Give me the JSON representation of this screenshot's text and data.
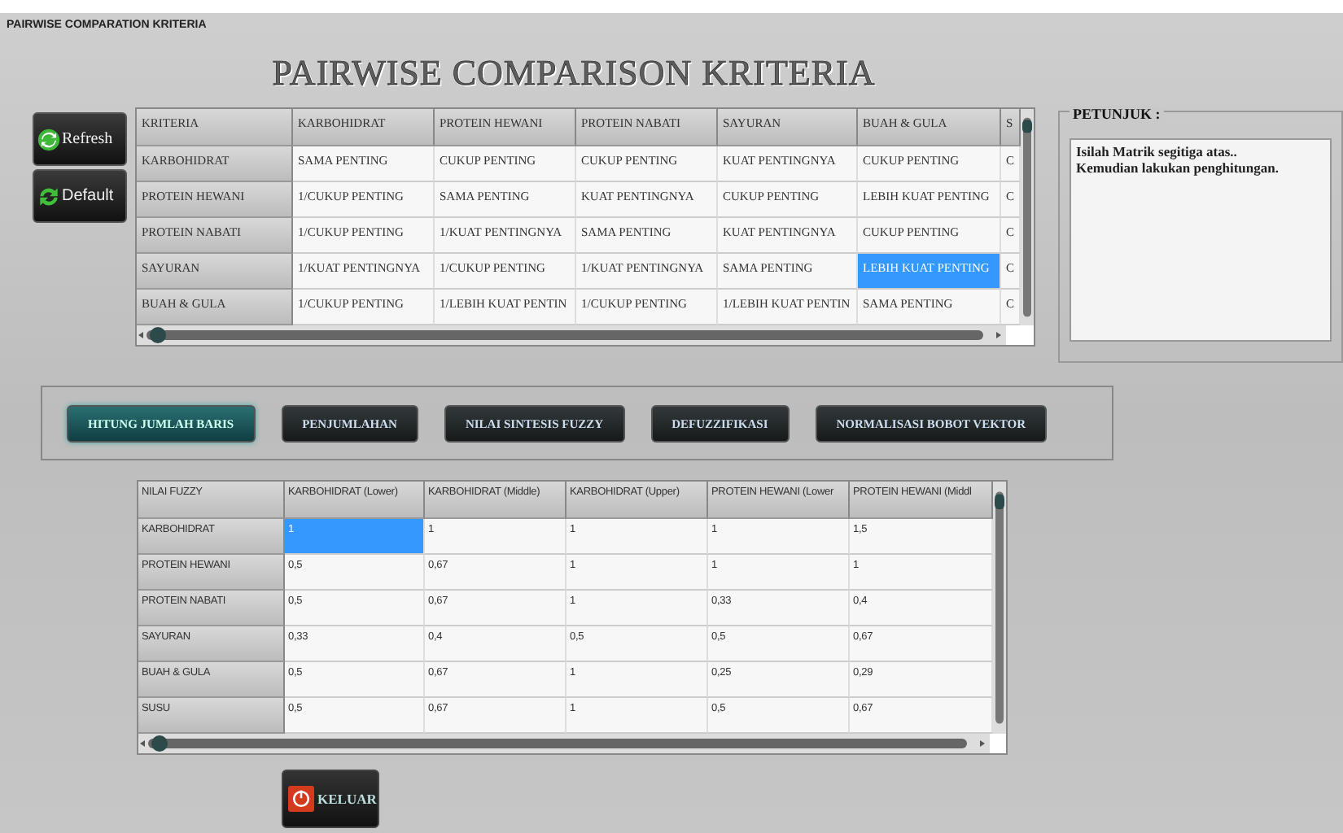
{
  "window": {
    "title": "PAIRWISE COMPARATION KRITERIA"
  },
  "heading": "PAIRWISE COMPARISON KRITERIA",
  "side_buttons": [
    {
      "label": "Refresh",
      "kind": "refresh"
    },
    {
      "label": "Default",
      "kind": "default"
    }
  ],
  "matrix": {
    "corner": "KRITERIA",
    "columns": [
      "KARBOHIDRAT",
      "PROTEIN HEWANI",
      "PROTEIN NABATI",
      "SAYURAN",
      "BUAH & GULA",
      "S"
    ],
    "rows": [
      {
        "label": "KARBOHIDRAT",
        "cells": [
          {
            "text": "SAMA PENTING",
            "selected": false
          },
          {
            "text": "CUKUP PENTING",
            "selected": false
          },
          {
            "text": "CUKUP PENTING",
            "selected": false
          },
          {
            "text": "KUAT PENTINGNYA",
            "selected": false
          },
          {
            "text": "CUKUP PENTING",
            "selected": false
          },
          {
            "text": "C",
            "selected": false
          }
        ]
      },
      {
        "label": "PROTEIN HEWANI",
        "cells": [
          {
            "text": "1/CUKUP PENTING",
            "selected": false
          },
          {
            "text": "SAMA PENTING",
            "selected": false
          },
          {
            "text": "KUAT PENTINGNYA",
            "selected": false
          },
          {
            "text": "CUKUP PENTING",
            "selected": false
          },
          {
            "text": "LEBIH KUAT PENTING",
            "selected": false
          },
          {
            "text": "C",
            "selected": false
          }
        ]
      },
      {
        "label": "PROTEIN NABATI",
        "cells": [
          {
            "text": "1/CUKUP PENTING",
            "selected": false
          },
          {
            "text": "1/KUAT PENTINGNYA",
            "selected": false
          },
          {
            "text": "SAMA PENTING",
            "selected": false
          },
          {
            "text": "KUAT PENTINGNYA",
            "selected": false
          },
          {
            "text": "CUKUP PENTING",
            "selected": false
          },
          {
            "text": "C",
            "selected": false
          }
        ]
      },
      {
        "label": "SAYURAN",
        "cells": [
          {
            "text": "1/KUAT PENTINGNYA",
            "selected": false
          },
          {
            "text": "1/CUKUP PENTING",
            "selected": false
          },
          {
            "text": "1/KUAT PENTINGNYA",
            "selected": false
          },
          {
            "text": "SAMA PENTING",
            "selected": false
          },
          {
            "text": "LEBIH KUAT PENTING",
            "selected": true
          },
          {
            "text": "C",
            "selected": false
          }
        ]
      },
      {
        "label": "BUAH & GULA",
        "cells": [
          {
            "text": "1/CUKUP PENTING",
            "selected": false
          },
          {
            "text": "1/LEBIH KUAT PENTIN",
            "selected": false
          },
          {
            "text": "1/CUKUP PENTING",
            "selected": false
          },
          {
            "text": "1/LEBIH KUAT PENTIN",
            "selected": false
          },
          {
            "text": "SAMA PENTING",
            "selected": false
          },
          {
            "text": "C",
            "selected": false
          }
        ]
      }
    ]
  },
  "petunjuk": {
    "title": "PETUNJUK :",
    "lines": [
      "Isilah Matrik segitiga atas..",
      "Kemudian lakukan penghitungan."
    ]
  },
  "steps": [
    {
      "label": "HITUNG JUMLAH BARIS",
      "selected": true
    },
    {
      "label": "PENJUMLAHAN",
      "selected": false
    },
    {
      "label": "NILAI SINTESIS FUZZY",
      "selected": false
    },
    {
      "label": "DEFUZZIFIKASI",
      "selected": false
    },
    {
      "label": "NORMALISASI BOBOT VEKTOR",
      "selected": false
    }
  ],
  "fuzzy": {
    "corner": "NILAI FUZZY",
    "columns": [
      "KARBOHIDRAT (Lower)",
      "KARBOHIDRAT (Middle)",
      "KARBOHIDRAT (Upper)",
      "PROTEIN HEWANI (Lower",
      "PROTEIN HEWANI (Middl"
    ],
    "rows": [
      {
        "label": "KARBOHIDRAT",
        "cells": [
          {
            "text": "1",
            "selected": true
          },
          {
            "text": "1",
            "selected": false
          },
          {
            "text": "1",
            "selected": false
          },
          {
            "text": "1",
            "selected": false
          },
          {
            "text": "1,5",
            "selected": false
          }
        ]
      },
      {
        "label": "PROTEIN HEWANI",
        "cells": [
          {
            "text": "0,5",
            "selected": false
          },
          {
            "text": "0,67",
            "selected": false
          },
          {
            "text": "1",
            "selected": false
          },
          {
            "text": "1",
            "selected": false
          },
          {
            "text": "1",
            "selected": false
          }
        ]
      },
      {
        "label": "PROTEIN NABATI",
        "cells": [
          {
            "text": "0,5",
            "selected": false
          },
          {
            "text": "0,67",
            "selected": false
          },
          {
            "text": "1",
            "selected": false
          },
          {
            "text": "0,33",
            "selected": false
          },
          {
            "text": "0,4",
            "selected": false
          }
        ]
      },
      {
        "label": "SAYURAN",
        "cells": [
          {
            "text": "0,33",
            "selected": false
          },
          {
            "text": "0,4",
            "selected": false
          },
          {
            "text": "0,5",
            "selected": false
          },
          {
            "text": "0,5",
            "selected": false
          },
          {
            "text": "0,67",
            "selected": false
          }
        ]
      },
      {
        "label": "BUAH & GULA",
        "cells": [
          {
            "text": "0,5",
            "selected": false
          },
          {
            "text": "0,67",
            "selected": false
          },
          {
            "text": "1",
            "selected": false
          },
          {
            "text": "0,25",
            "selected": false
          },
          {
            "text": "0,29",
            "selected": false
          }
        ]
      },
      {
        "label": "SUSU",
        "cells": [
          {
            "text": "0,5",
            "selected": false
          },
          {
            "text": "0,67",
            "selected": false
          },
          {
            "text": "1",
            "selected": false
          },
          {
            "text": "0,5",
            "selected": false
          },
          {
            "text": "0,67",
            "selected": false
          }
        ]
      }
    ]
  },
  "exit_button": {
    "label": "KELUAR"
  }
}
